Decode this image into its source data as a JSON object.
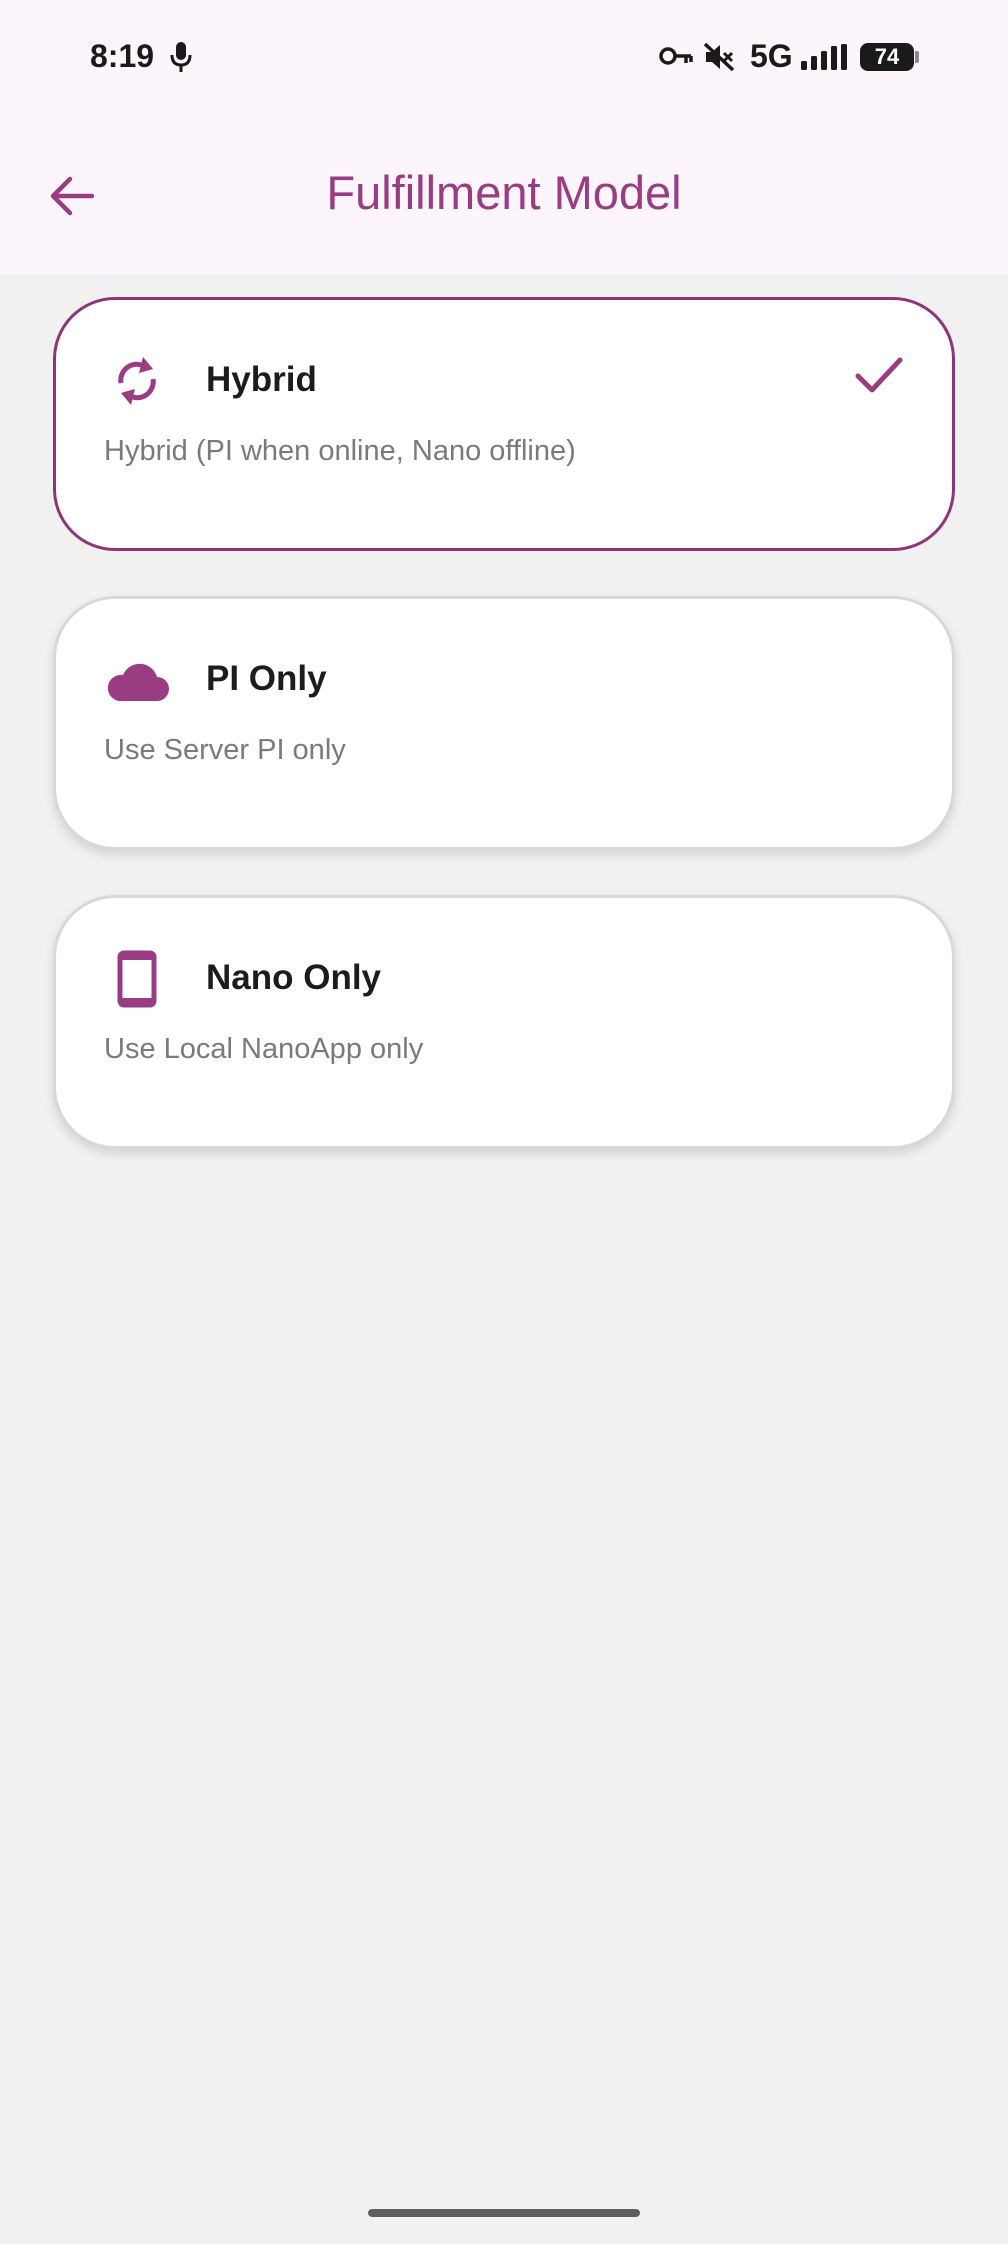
{
  "status_bar": {
    "time": "8:19",
    "network": "5G",
    "battery": "74",
    "icons": [
      "mic-icon",
      "vpn-key-icon",
      "mute-icon",
      "signal-icon",
      "battery-icon"
    ]
  },
  "app_bar": {
    "title": "Fulfillment Model",
    "back_icon": "arrow-back-icon"
  },
  "options": [
    {
      "icon": "sync-icon",
      "title": "Hybrid",
      "subtitle": "Hybrid (PI when online, Nano offline)",
      "selected": true
    },
    {
      "icon": "cloud-icon",
      "title": "PI Only",
      "subtitle": "Use Server PI only",
      "selected": false
    },
    {
      "icon": "phone-icon",
      "title": "Nano Only",
      "subtitle": "Use Local NanoApp only",
      "selected": false
    }
  ],
  "colors": {
    "accent": "#993c82",
    "selected_border": "#8f3478",
    "background": "#f1f1f1",
    "bar_background": "#fcf5fb"
  }
}
